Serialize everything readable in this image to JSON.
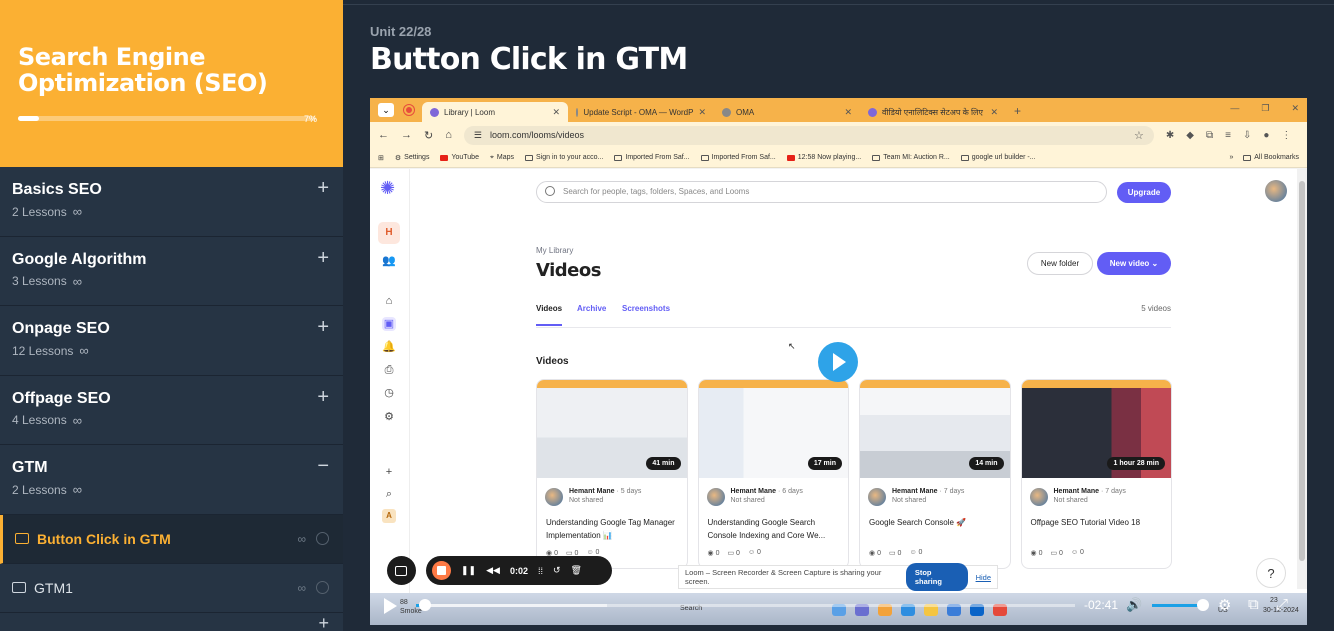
{
  "course": {
    "title": "Search Engine Optimization (SEO)",
    "progress_percent": 7,
    "progress_label": "7%"
  },
  "sections": [
    {
      "title": "Basics SEO",
      "lessons": "2 Lessons",
      "toggle": "+"
    },
    {
      "title": "Google Algorithm",
      "lessons": "3 Lessons",
      "toggle": "+"
    },
    {
      "title": "Onpage SEO",
      "lessons": "12 Lessons",
      "toggle": "+"
    },
    {
      "title": "Offpage SEO",
      "lessons": "4 Lessons",
      "toggle": "+"
    },
    {
      "title": "GTM",
      "lessons": "2 Lessons",
      "toggle": "−"
    }
  ],
  "gtm_lessons": [
    {
      "label": "Button Click in GTM",
      "active": true
    },
    {
      "label": "GTM1",
      "active": false
    }
  ],
  "header": {
    "unit": "Unit 22/28",
    "title": "Button Click in GTM"
  },
  "browser": {
    "tabs": [
      {
        "label": "Library | Loom",
        "active": true
      },
      {
        "label": "Update Script - OMA — WordP",
        "active": false
      },
      {
        "label": "OMA",
        "active": false
      },
      {
        "label": "वीडियो एनालिटिक्स सेटअप के लिए",
        "active": false
      }
    ],
    "url": "loom.com/looms/videos",
    "bookmarks": [
      "Settings",
      "YouTube",
      "Maps",
      "Sign in to your acco...",
      "Imported From Saf...",
      "Imported From Saf...",
      "12:58 Now playing...",
      "Team MI: Auction R...",
      "google url builder -..."
    ],
    "all_bookmarks": "All Bookmarks"
  },
  "loom": {
    "search_placeholder": "Search for people, tags, folders, Spaces, and Looms",
    "upgrade": "Upgrade",
    "breadcrumb": "My Library",
    "heading": "Videos",
    "new_folder": "New folder",
    "new_video": "New video",
    "tabs": [
      "Videos",
      "Archive",
      "Screenshots"
    ],
    "count": "5 videos",
    "subheading": "Videos",
    "rail_h": "H",
    "rail_a": "A",
    "cards": [
      {
        "duration": "41 min",
        "author": "Hemant Mane",
        "days": "· 5 days",
        "shared": "Not shared",
        "title": "Understanding Google Tag Manager Implementation 📊",
        "views": "0",
        "comments": "0",
        "reactions": "0"
      },
      {
        "duration": "17 min",
        "author": "Hemant Mane",
        "days": "· 6 days",
        "shared": "Not shared",
        "title": "Understanding Google Search Console Indexing and Core We...",
        "views": "0",
        "comments": "0",
        "reactions": "0"
      },
      {
        "duration": "14 min",
        "author": "Hemant Mane",
        "days": "· 7 days",
        "shared": "Not shared",
        "title": "Google Search Console 🚀",
        "views": "0",
        "comments": "0",
        "reactions": "0"
      },
      {
        "duration": "1 hour 28 min",
        "author": "Hemant Mane",
        "days": "· 7 days",
        "shared": "Not shared",
        "title": "Offpage SEO Tutorial Video 18",
        "views": "0",
        "comments": "0",
        "reactions": "0"
      }
    ]
  },
  "recorder": {
    "time": "0:02",
    "banner": "Loom – Screen Recorder & Screen Capture is sharing your screen.",
    "stop_sharing": "Stop sharing",
    "hide": "Hide",
    "help": "?"
  },
  "taskbar": {
    "weather_temp": "88",
    "weather_label": "Smoke",
    "search": "Search",
    "lang": "US",
    "clock_time": "23",
    "clock_date": "30-12-2024"
  },
  "player": {
    "remaining": "-02:41",
    "played_fraction": 0.012,
    "buffered_fraction": 0.29,
    "volume_fraction": 1.0
  }
}
